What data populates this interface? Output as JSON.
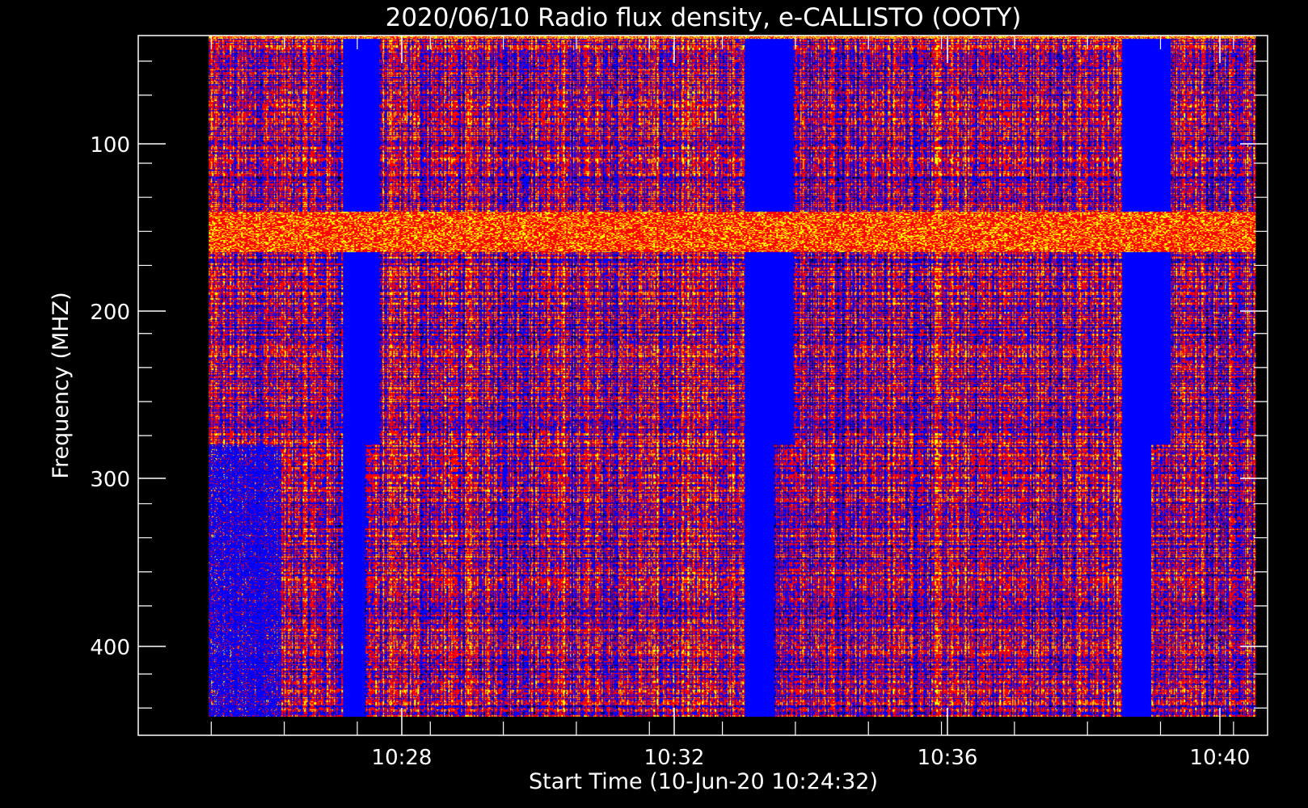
{
  "chart_data": {
    "type": "heatmap",
    "title": "2020/06/10  Radio flux density, e-CALLISTO (OOTY)",
    "xlabel": "Start Time (10-Jun-20 10:24:32)",
    "ylabel": "Frequency (MHZ)",
    "x_range": [
      "10:24:32",
      "10:40:00"
    ],
    "data_x_range": [
      "10:25:30",
      "10:39:50"
    ],
    "ylim": [
      456,
      45
    ],
    "data_y_range": [
      445,
      45
    ],
    "x_ticks": [
      "10:28",
      "10:32",
      "10:36",
      "10:40"
    ],
    "y_ticks": [
      100,
      200,
      300,
      400
    ],
    "colormap": [
      "#000000",
      "#0000ff",
      "#ff0000",
      "#ffff00"
    ],
    "features": [
      {
        "label": "bright interference band",
        "freq_range_mhz": [
          148,
          172
        ]
      },
      {
        "label": "band edge",
        "freq_mhz": 285
      },
      {
        "label": "blue-dominated intervals",
        "time_ranges": [
          [
            "10:27:20",
            "10:27:50"
          ],
          [
            "10:32:50",
            "10:33:30"
          ],
          [
            "10:38:00",
            "10:38:40"
          ]
        ]
      }
    ]
  }
}
